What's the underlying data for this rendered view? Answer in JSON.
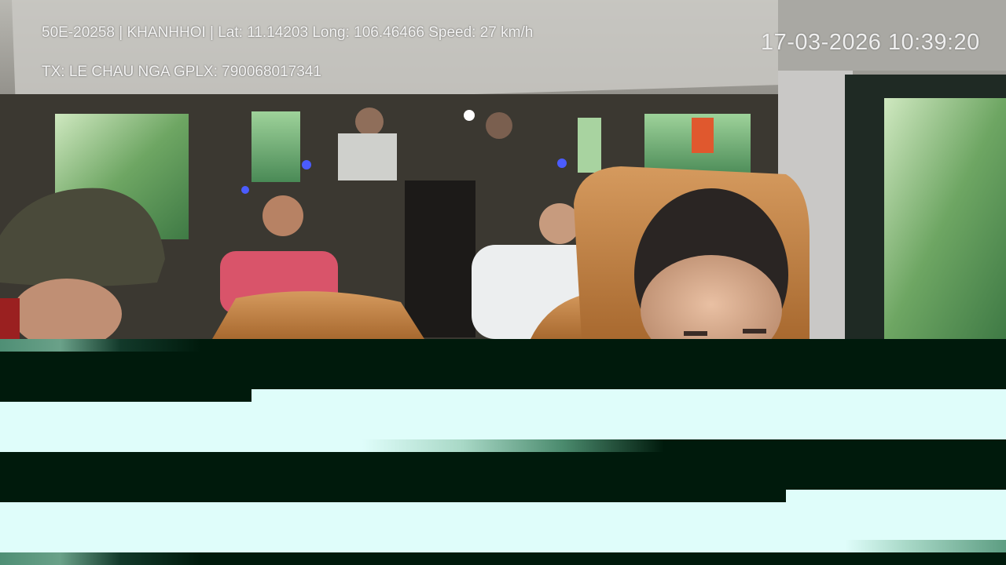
{
  "osd": {
    "line1": "50E-20258 | KHANHHOI | Lat: 11.14203 Long: 106.46466 Speed: 27 km/h",
    "line2": "TX: LE CHAU NGA GPLX: 790068017341",
    "timestamp": "17-03-2026 10:39:20"
  },
  "colors": {
    "overlay_text": "#f4f4f4",
    "corruption_dark": "#001a0c",
    "corruption_light": "#dffdfa",
    "seat_leather": "#c98a4e",
    "foliage": "#5f9a5a"
  }
}
